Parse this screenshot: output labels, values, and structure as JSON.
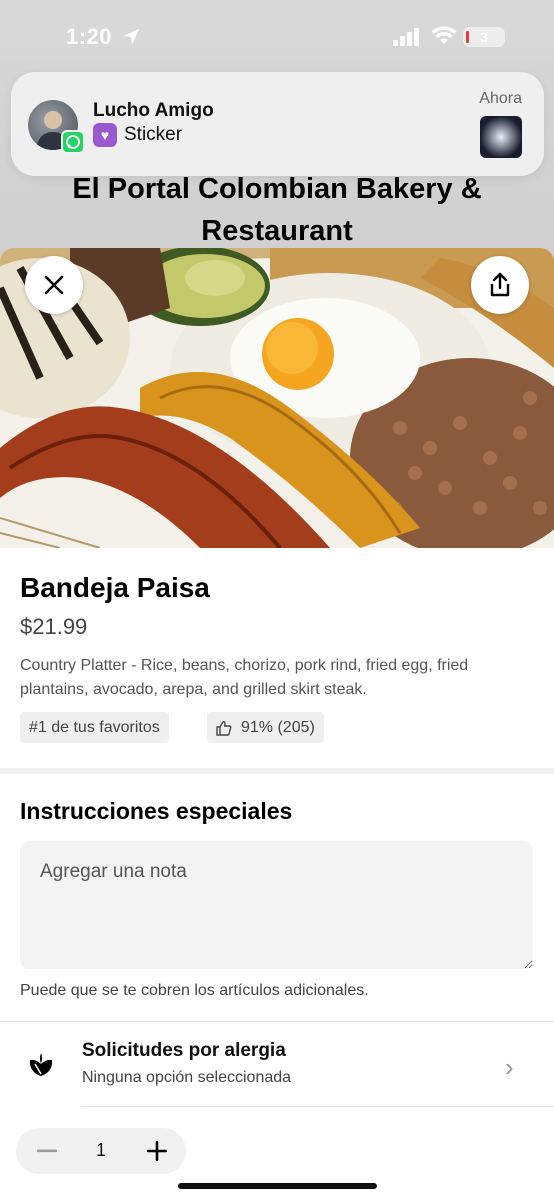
{
  "status_bar": {
    "time": "1:20",
    "battery": "3"
  },
  "notification": {
    "sender": "Lucho Amigo",
    "body": "Sticker",
    "time": "Ahora"
  },
  "restaurant": {
    "name": "El Portal Colombian Bakery & Restaurant"
  },
  "item": {
    "name": "Bandeja Paisa",
    "price": "$21.99",
    "description": "Country Platter - Rice, beans, chorizo, pork rind, fried egg, fried plantains, avocado, arepa, and grilled skirt steak.",
    "badge_favorite": "#1 de tus favoritos",
    "rating": "91% (205)"
  },
  "special_instructions": {
    "title": "Instrucciones especiales",
    "placeholder": "Agregar una nota",
    "hint": "Puede que se te cobren los artículos adicionales."
  },
  "allergy": {
    "title": "Solicitudes por alergia",
    "subtitle": "Ninguna opción seleccionada"
  },
  "quantity": {
    "value": "1"
  },
  "colors": {
    "accent": "#000000",
    "whatsapp": "#25d366",
    "sticker": "#9b59d0"
  }
}
